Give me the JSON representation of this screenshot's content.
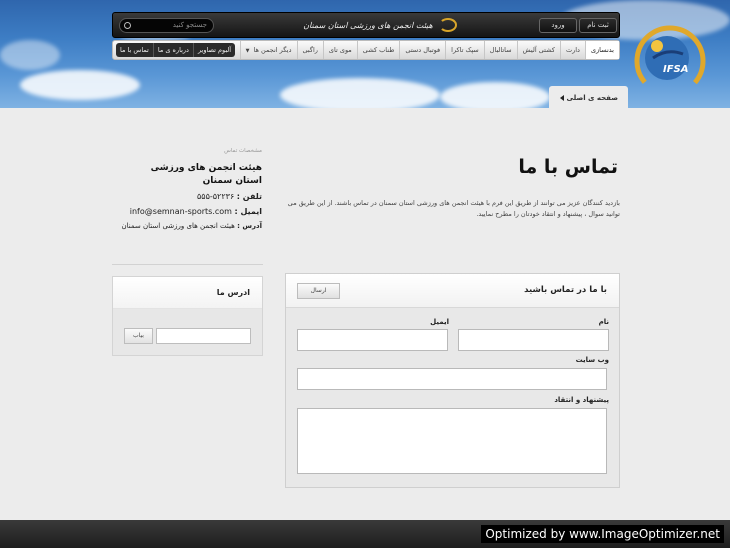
{
  "header": {
    "search_placeholder": "جستجو کنید",
    "site_title": "هیئت انجمن های ورزشی استان سمنان",
    "register_label": "ثبت نام",
    "login_label": "ورود",
    "logo_text": "IFSA"
  },
  "nav": {
    "items": [
      {
        "label": "بدنسازی"
      },
      {
        "label": "دارت"
      },
      {
        "label": "کشتی آلیش"
      },
      {
        "label": "ساتالبال"
      },
      {
        "label": "سپک تاکرا"
      },
      {
        "label": "فوتبال دستی"
      },
      {
        "label": "طناب کشی"
      },
      {
        "label": "موی تای"
      },
      {
        "label": "راگبی"
      },
      {
        "label": "دیگر انجمن ها"
      }
    ],
    "left_items": [
      {
        "label": "تماس با ما"
      },
      {
        "label": "درباره ی ما"
      },
      {
        "label": "آلبوم تصاویر"
      }
    ]
  },
  "breadcrumb": {
    "home_label": "صفحه ی اصلی"
  },
  "contact_info": {
    "small_heading": "مشخصات تماس",
    "org_name": "هیئت انجمن های ورزشی استان سمنان",
    "phone_label": "تلفن :",
    "phone_value": "۵۲۲۳۶-۵۵۵",
    "email_label": "ایمیل :",
    "email_value": "info@semnan-sports.com",
    "address_label": "آدرس :",
    "address_value": "هیئت انجمن های ورزشی استان سمنان"
  },
  "newsletter": {
    "title": "ادرس ما",
    "button_label": "بیاب"
  },
  "main": {
    "page_title": "تماس با ما",
    "description": "بازدید کنندگان عزیز می توانند از طریق این فرم با هیئت انجمن های ورزشی استان سمنان در تماس باشند. از این طریق می توانید سوال ، پیشنهاد و انتقاد خودتان را مطرح نمایید."
  },
  "form": {
    "title": "با ما در تماس باشید",
    "send_label": "ارسال",
    "name_label": "نام",
    "email_label": "ایمیل",
    "website_label": "وب سایت",
    "suggestion_label": "پیشنهاد و انتقاد"
  },
  "footer": {
    "optimized_text": "Optimized by www.ImageOptimizer.net"
  }
}
